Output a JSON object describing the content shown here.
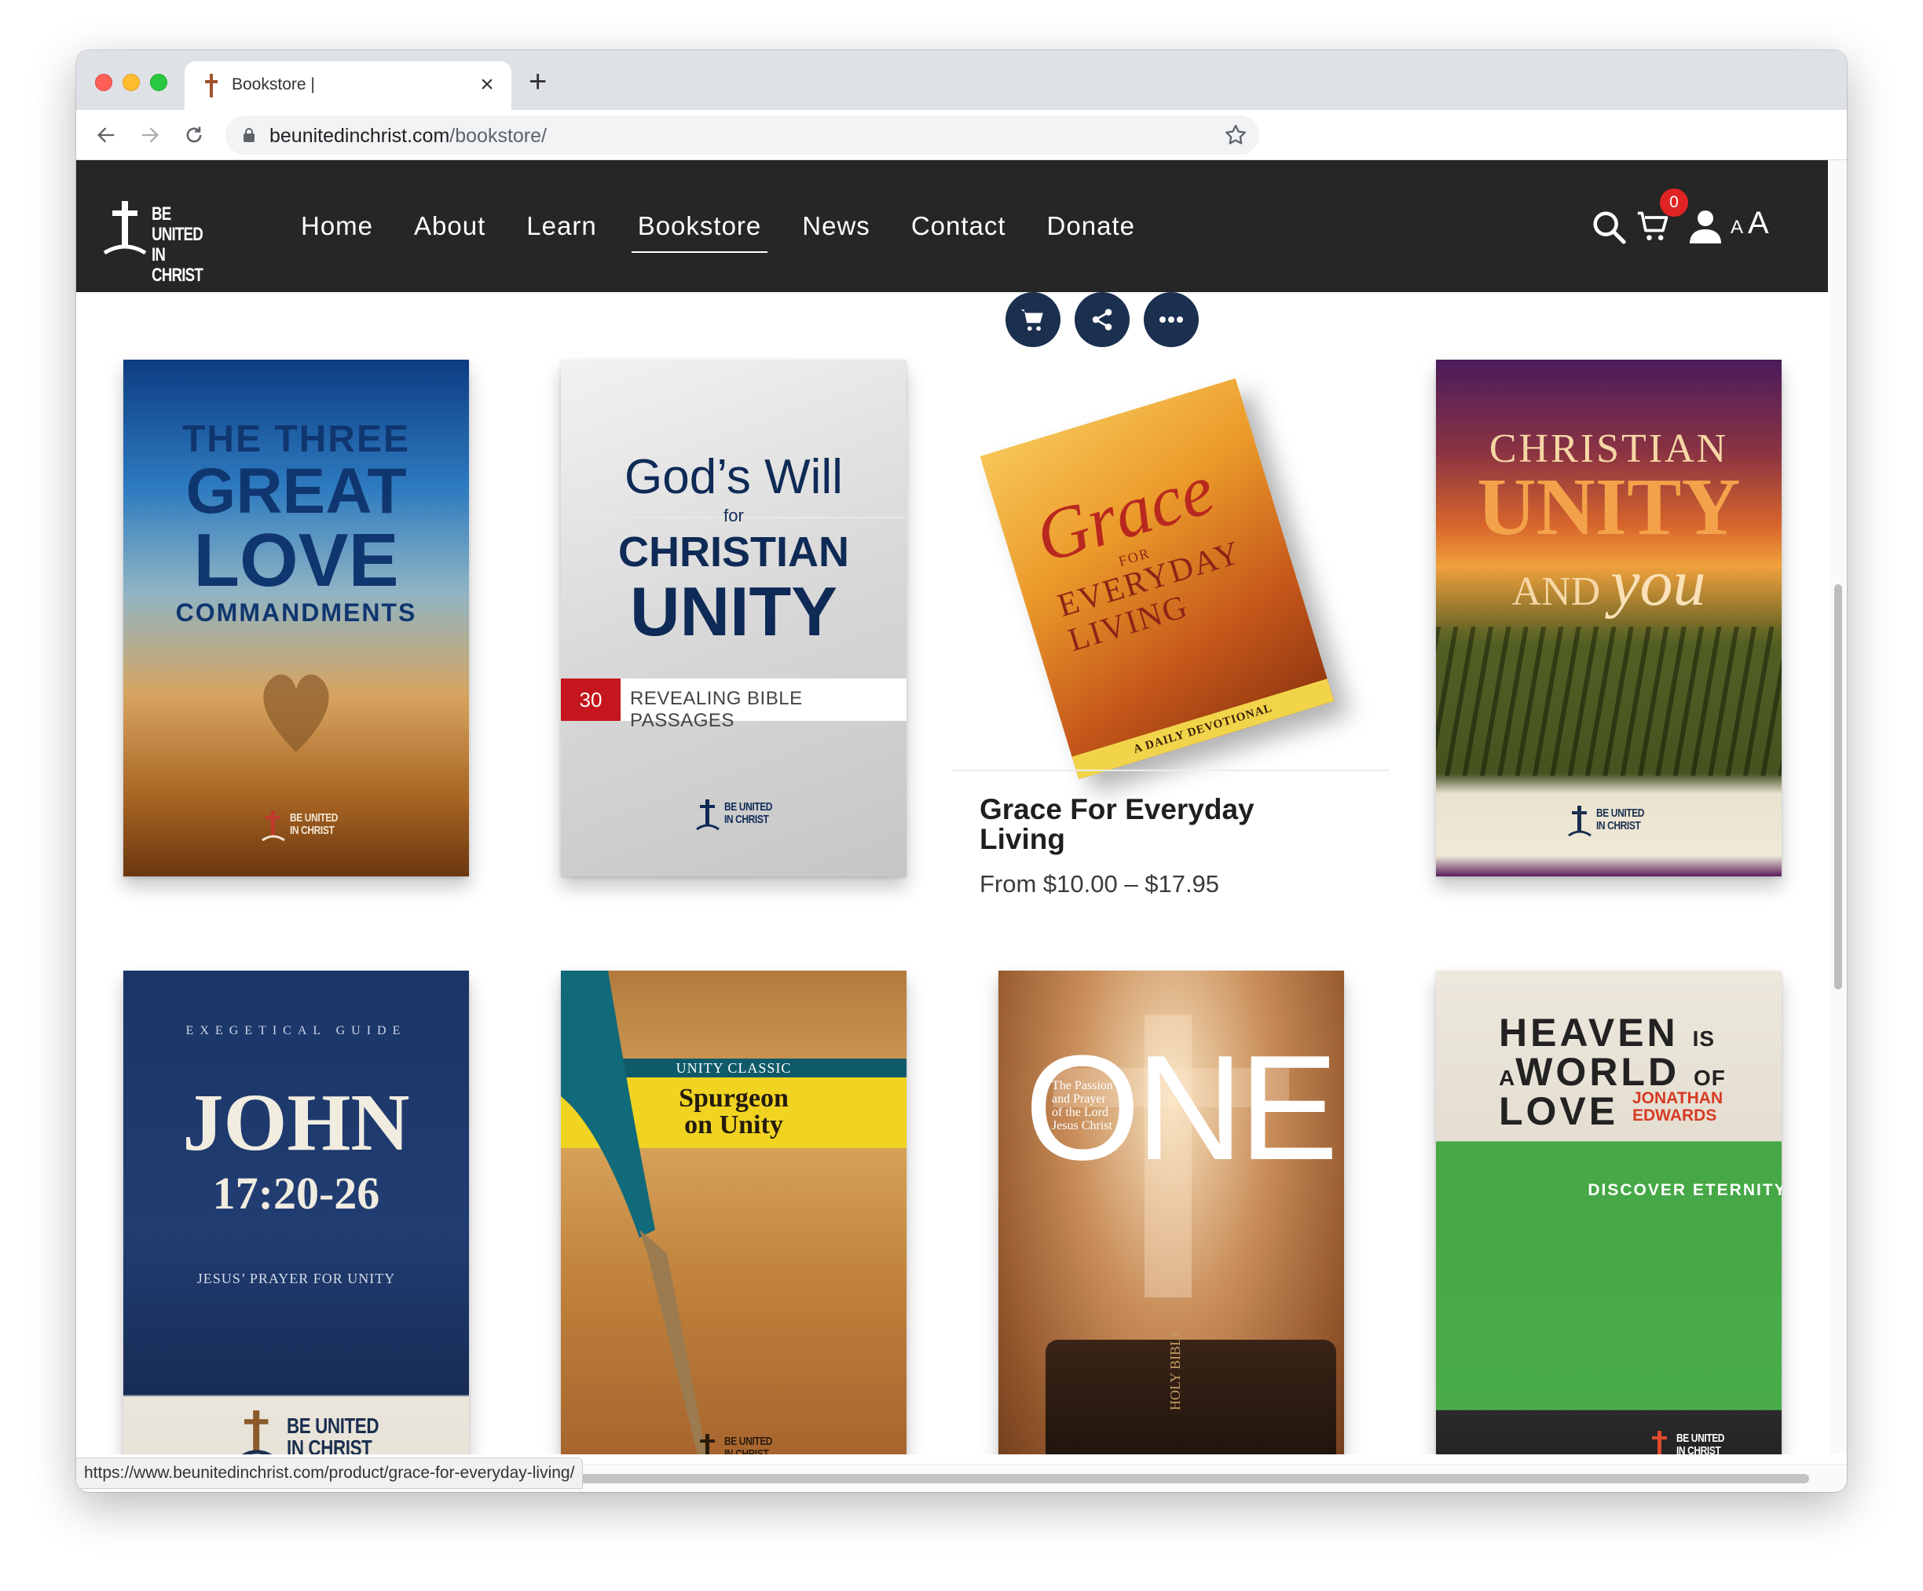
{
  "browser": {
    "tab_title": "Bookstore |",
    "url_host": "beunitedinchrist.com",
    "url_path": "/bookstore/",
    "status_url": "https://www.beunitedinchrist.com/product/grace-for-everyday-living/"
  },
  "site": {
    "logo_line1": "BE UNITED",
    "logo_line2": "IN CHRIST",
    "nav": [
      "Home",
      "About",
      "Learn",
      "Bookstore",
      "News",
      "Contact",
      "Donate"
    ],
    "active_nav": "Bookstore",
    "cart_count": "0",
    "font_small": "A",
    "font_large": "A",
    "colors": {
      "header_bg": "#262626",
      "accent_navy": "#1b2f4f",
      "badge_red": "#e02424"
    }
  },
  "books": {
    "b1": {
      "l1": "THE THREE",
      "l2": "GREAT",
      "l3": "LOVE",
      "l4": "COMMANDMENTS"
    },
    "b2": {
      "l1": "God’s Will",
      "l2": "for",
      "l3": "CHRISTIAN",
      "l4": "UNITY",
      "num": "30",
      "subtitle": "REVEALING BIBLE PASSAGES"
    },
    "b3": {
      "g1": "Grace",
      "g2": "FOR",
      "g3a": "EVERYDAY",
      "g3b": "LIVING",
      "g4": "A DAILY DEVOTIONAL"
    },
    "b4": {
      "l1": "CHRISTIAN",
      "l2": "UNITY",
      "l3": "AND",
      "l3b": "you"
    },
    "b5": {
      "l1": "EXEGETICAL GUIDE",
      "l2": "JOHN",
      "l3": "17:20-26",
      "l4": "JESUS’ PRAYER FOR UNITY"
    },
    "b6": {
      "l1": "UNITY CLASSIC",
      "l2": "Spurgeon",
      "l3": "on Unity"
    },
    "b7": {
      "l1": "ONE",
      "small": "The Passion and Prayer of the Lord Jesus Christ",
      "bible": "HOLY BIBLE"
    },
    "b8": {
      "l1a": "HEAVEN",
      "l1b": "IS",
      "l2a": "A",
      "l2b": "WORLD",
      "l2c": "OF",
      "l3": "LOVE",
      "author1": "JONATHAN",
      "author2": "EDWARDS",
      "tag": "DISCOVER ETERNITY"
    }
  },
  "hovered_product": {
    "title": "Grace For Everyday Living",
    "price": "From $10.00 – $17.95",
    "actions": [
      "add-to-cart",
      "share",
      "more"
    ]
  }
}
